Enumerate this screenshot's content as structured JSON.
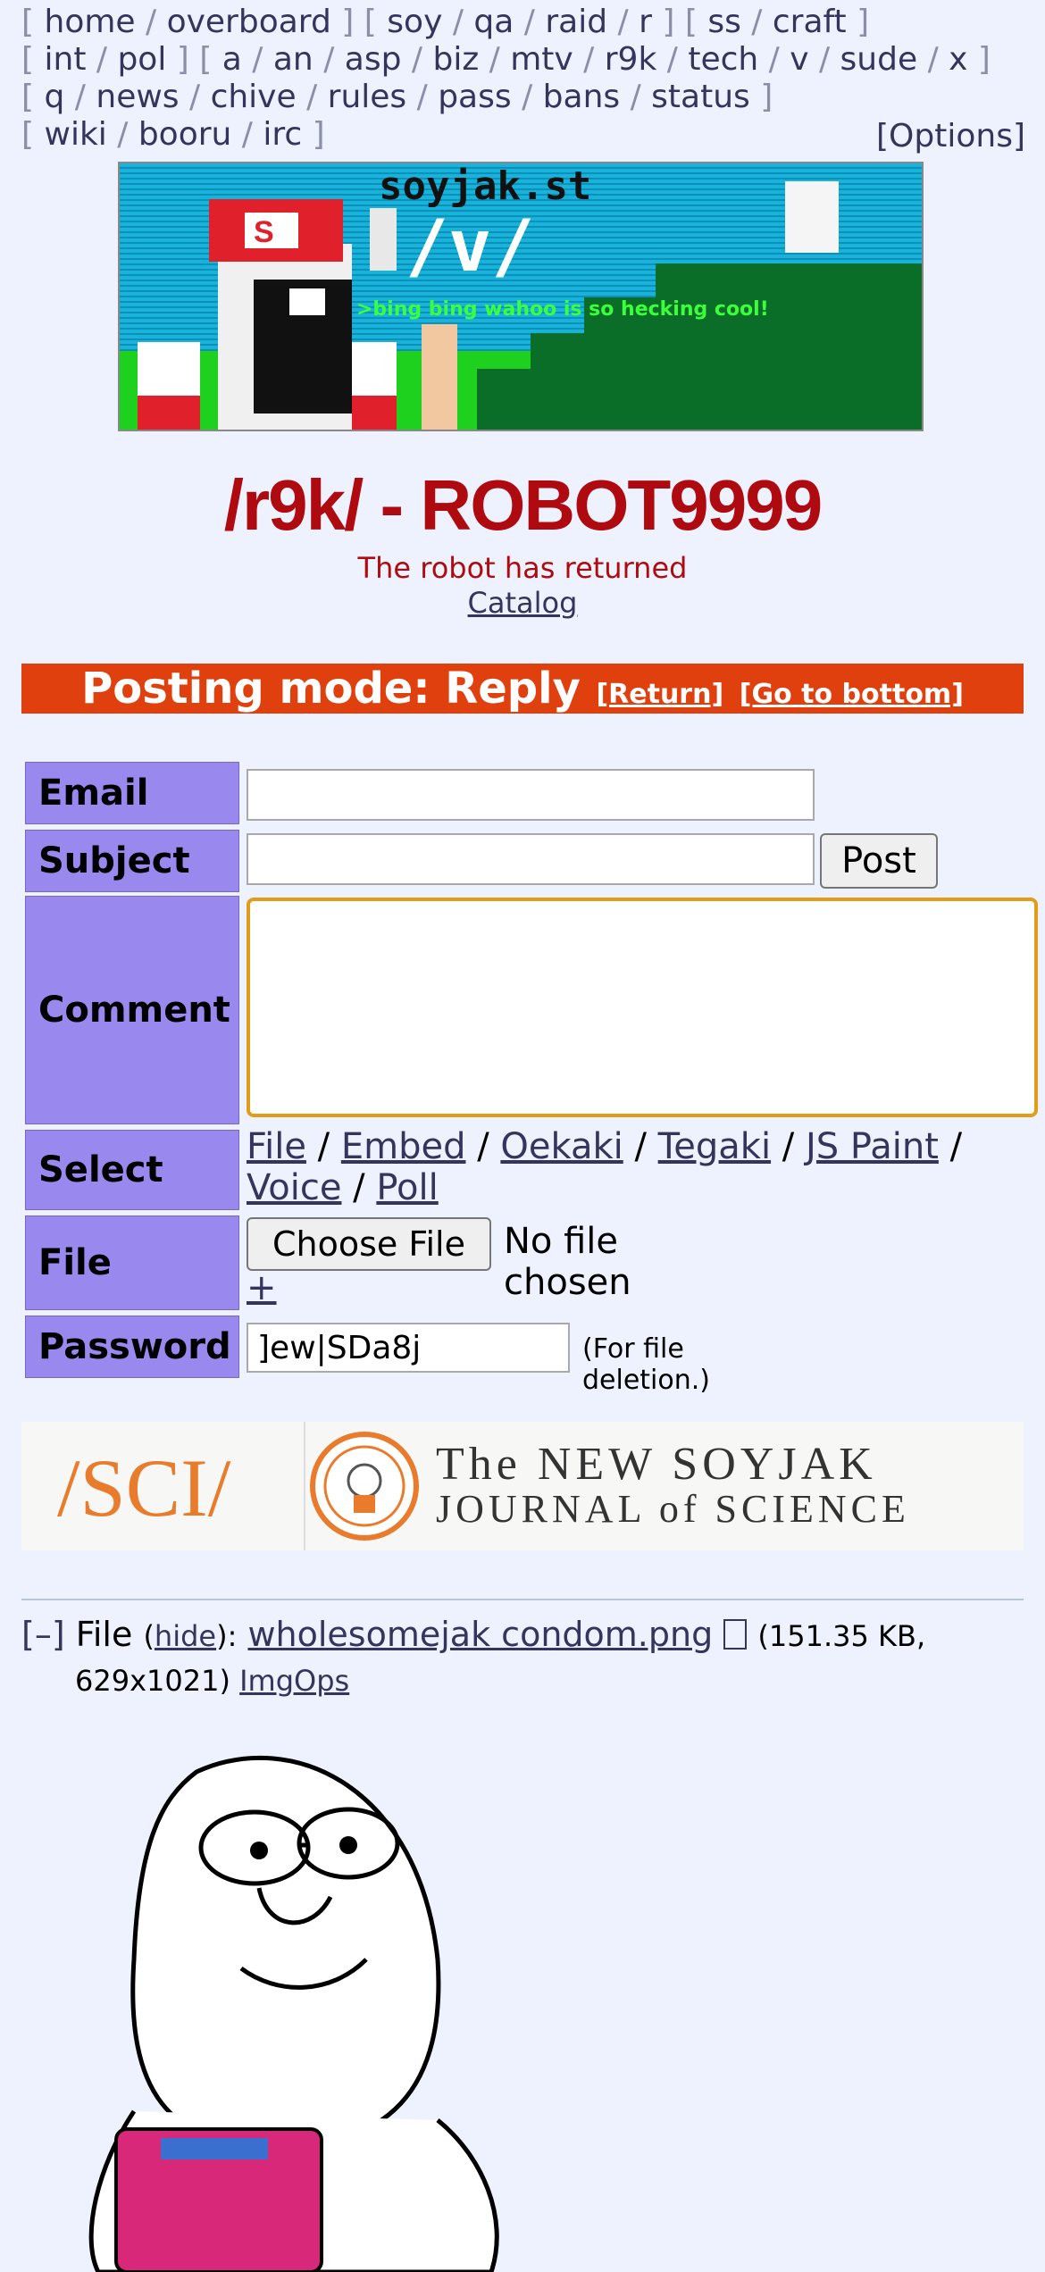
{
  "nav": {
    "groups": [
      [
        "home",
        "overboard"
      ],
      [
        "soy",
        "qa",
        "raid",
        "r"
      ],
      [
        "ss",
        "craft"
      ],
      [
        "int",
        "pol"
      ],
      [
        "a",
        "an",
        "asp",
        "biz",
        "mtv",
        "r9k",
        "tech",
        "v",
        "sude",
        "x"
      ],
      [
        "q",
        "news",
        "chive",
        "rules",
        "pass",
        "bans",
        "status"
      ],
      [
        "wiki",
        "booru",
        "irc"
      ]
    ],
    "options_label": "[Options]"
  },
  "banner": {
    "site": "soyjak.st",
    "board": "/v/",
    "greentext": ">bing bing wahoo is so hecking cool!"
  },
  "board": {
    "title": "/r9k/ - ROBOT9999",
    "subtitle": "The robot has returned",
    "catalog_label": "Catalog"
  },
  "mode": {
    "title": "Posting mode: Reply",
    "return_label": "[Return]",
    "bottom_label": "[Go to bottom]"
  },
  "form": {
    "email_label": "Email",
    "subject_label": "Subject",
    "comment_label": "Comment",
    "select_label": "Select",
    "file_label": "File",
    "password_label": "Password",
    "post_button": "Post",
    "select_options": [
      "File",
      "Embed",
      "Oekaki",
      "Tegaki",
      "JS Paint",
      "Voice",
      "Poll"
    ],
    "choose_file_button": "Choose File",
    "no_file_text": "No file chosen",
    "add_file": "+",
    "password_value": "]ew|SDa8j",
    "password_note": "(For file deletion.)"
  },
  "ad": {
    "left_text": "/SCI/",
    "line1": "The NEW SOYJAK",
    "line2": "JOURNAL of SCIENCE"
  },
  "post": {
    "collapse": "[–]",
    "file_word": "File",
    "hide_label": "hide",
    "filename": "wholesomejak condom.png",
    "size": "151.35 KB,",
    "dims": "629x1021)",
    "imgops": "ImgOps"
  },
  "colors": {
    "background": "#eef2ff",
    "title_red": "#af0a0f",
    "mode_bar": "#e0400e",
    "label_purple": "#9988ee",
    "link": "#34345c"
  }
}
